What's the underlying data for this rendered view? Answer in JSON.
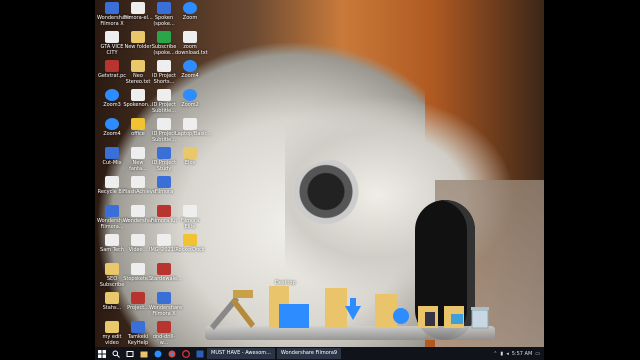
{
  "desktop": {
    "icons": [
      {
        "label": "Wondershare Filmora X",
        "icon": "filmora-icon",
        "color": "g-w",
        "col": 0,
        "row": 0
      },
      {
        "label": "Filmora-el...",
        "icon": "filmora-icon",
        "color": "g-d",
        "col": 1,
        "row": 0
      },
      {
        "label": "Spoken (spoke...",
        "icon": "app-icon",
        "color": "g-w",
        "col": 2,
        "row": 0
      },
      {
        "label": "Zoom",
        "icon": "zoom-icon",
        "color": "g-z",
        "col": 3,
        "row": 0
      },
      {
        "label": "GTA VICE CITY",
        "icon": "game-icon",
        "color": "g-d",
        "col": 0,
        "row": 1
      },
      {
        "label": "New folder",
        "icon": "folder-icon",
        "color": "g-f",
        "col": 1,
        "row": 1
      },
      {
        "label": "Subscribe (spoke...",
        "icon": "app-icon",
        "color": "g-g",
        "col": 2,
        "row": 1
      },
      {
        "label": "zoom download.txt",
        "icon": "document-icon",
        "color": "g-d",
        "col": 3,
        "row": 1
      },
      {
        "label": "Getstrat.pc",
        "icon": "app-icon",
        "color": "g-r",
        "col": 0,
        "row": 2
      },
      {
        "label": "Neo Stereo.txt",
        "icon": "document-icon",
        "color": "g-f",
        "col": 1,
        "row": 2
      },
      {
        "label": "ID Project Shorts...",
        "icon": "document-icon",
        "color": "g-d",
        "col": 2,
        "row": 2
      },
      {
        "label": "Zoom4",
        "icon": "zoom-icon",
        "color": "g-z",
        "col": 3,
        "row": 2
      },
      {
        "label": "Zoom3",
        "icon": "zoom-icon",
        "color": "g-z",
        "col": 0,
        "row": 3
      },
      {
        "label": "Spokenon...",
        "icon": "document-icon",
        "color": "g-d",
        "col": 1,
        "row": 3
      },
      {
        "label": "ID Project Subtitle...",
        "icon": "document-icon",
        "color": "g-d",
        "col": 2,
        "row": 3
      },
      {
        "label": "Zoom2",
        "icon": "zoom-icon",
        "color": "g-z",
        "col": 3,
        "row": 3
      },
      {
        "label": "Zoom4",
        "icon": "zoom-icon",
        "color": "g-z",
        "col": 0,
        "row": 4
      },
      {
        "label": "office",
        "icon": "document-icon",
        "color": "g-y",
        "col": 1,
        "row": 4
      },
      {
        "label": "ID Project Subtitle...",
        "icon": "document-icon",
        "color": "g-d",
        "col": 2,
        "row": 4
      },
      {
        "label": "Laptop/Basic...",
        "icon": "laptop-icon",
        "color": "g-d",
        "col": 3,
        "row": 4
      },
      {
        "label": "Cut-Mix",
        "icon": "app-icon",
        "color": "g-w",
        "col": 0,
        "row": 5
      },
      {
        "label": "New fanta...",
        "icon": "document-icon",
        "color": "g-d",
        "col": 1,
        "row": 5
      },
      {
        "label": "ID Project Study",
        "icon": "document-icon",
        "color": "g-w",
        "col": 2,
        "row": 5
      },
      {
        "label": "Elos",
        "icon": "folder-icon",
        "color": "g-f",
        "col": 3,
        "row": 5
      },
      {
        "label": "Recycle Bin",
        "icon": "recycle-bin-icon",
        "color": "g-d",
        "col": 0,
        "row": 6
      },
      {
        "label": "FlashAchieve...",
        "icon": "app-icon",
        "color": "g-d",
        "col": 1,
        "row": 6
      },
      {
        "label": "Filmora",
        "icon": "filmora-icon",
        "color": "g-w",
        "col": 2,
        "row": 6
      },
      {
        "label": "Wondershare Filmora...",
        "icon": "filmora-icon",
        "color": "g-w",
        "col": 0,
        "row": 7
      },
      {
        "label": "Wondershare...",
        "icon": "app-icon",
        "color": "g-d",
        "col": 1,
        "row": 7
      },
      {
        "label": "Filmora Kit",
        "icon": "filmora-icon",
        "color": "g-r",
        "col": 2,
        "row": 7
      },
      {
        "label": "Filmora Elite",
        "icon": "filmora-icon",
        "color": "g-d",
        "col": 3,
        "row": 7
      },
      {
        "label": "Sam Tech",
        "icon": "person-icon",
        "color": "g-d",
        "col": 0,
        "row": 8
      },
      {
        "label": "Video...",
        "icon": "video-icon",
        "color": "g-d",
        "col": 1,
        "row": 8
      },
      {
        "label": "IMG_20210...",
        "icon": "image-icon",
        "color": "g-d",
        "col": 2,
        "row": 8
      },
      {
        "label": "RocketDock",
        "icon": "rocketdock-icon",
        "color": "g-y",
        "col": 3,
        "row": 8
      },
      {
        "label": "SEO Subscribe",
        "icon": "document-icon",
        "color": "g-f",
        "col": 0,
        "row": 9
      },
      {
        "label": "Stopskete...",
        "icon": "document-icon",
        "color": "g-d",
        "col": 1,
        "row": 9
      },
      {
        "label": "Stardewale...",
        "icon": "game-icon",
        "color": "g-r",
        "col": 2,
        "row": 9
      },
      {
        "label": "Stahs...",
        "icon": "document-icon",
        "color": "g-f",
        "col": 0,
        "row": 10
      },
      {
        "label": "Project...",
        "icon": "pdf-icon",
        "color": "g-r",
        "col": 1,
        "row": 10
      },
      {
        "label": "Wondershare Filmora X",
        "icon": "filmora-icon",
        "color": "g-w",
        "col": 2,
        "row": 10
      },
      {
        "label": "my edit video",
        "icon": "video-icon",
        "color": "g-f",
        "col": 0,
        "row": 11
      },
      {
        "label": "Tamkeki KeyHelp",
        "icon": "app-icon",
        "color": "g-w",
        "col": 1,
        "row": 11
      },
      {
        "label": "dnd-drill-w...",
        "icon": "app-icon",
        "color": "g-r",
        "col": 2,
        "row": 11
      }
    ]
  },
  "dock": {
    "hover_label": "Desktop",
    "items": [
      {
        "name": "tools-dock-icon"
      },
      {
        "name": "desktop-folder-dock-icon"
      },
      {
        "name": "downloads-folder-dock-icon"
      },
      {
        "name": "music-folder-dock-icon"
      },
      {
        "name": "documents-folder-dock-icon"
      },
      {
        "name": "pictures-folder-dock-icon"
      },
      {
        "name": "recycle-bin-dock-icon"
      }
    ]
  },
  "taskbar": {
    "tasks": [
      {
        "label": "MUST HAVE - Awesom...",
        "icon": "folder-icon"
      },
      {
        "label": "Wondershare Filmora9",
        "icon": "filmora-icon"
      }
    ],
    "clock": "5:57 AM"
  }
}
